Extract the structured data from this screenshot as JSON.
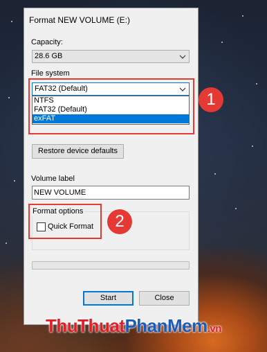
{
  "dialog": {
    "title": "Format NEW VOLUME (E:)",
    "capacity_label": "Capacity:",
    "capacity_value": "28.6 GB",
    "filesystem_label": "File system",
    "filesystem_value": "FAT32 (Default)",
    "filesystem_options": [
      "NTFS",
      "FAT32 (Default)",
      "exFAT"
    ],
    "filesystem_highlighted": "exFAT",
    "restore_button": "Restore device defaults",
    "volume_label_label": "Volume label",
    "volume_label_value": "NEW VOLUME",
    "format_options_label": "Format options",
    "quick_format_label": "Quick Format",
    "quick_format_checked": false,
    "progress": 0,
    "start_button": "Start",
    "close_button": "Close"
  },
  "annotations": {
    "badge_1": "1",
    "badge_2": "2",
    "color": "#e53935"
  },
  "watermark": {
    "part1": "ThuThuat",
    "part2": "PhanMem",
    "part3": ".vn"
  }
}
